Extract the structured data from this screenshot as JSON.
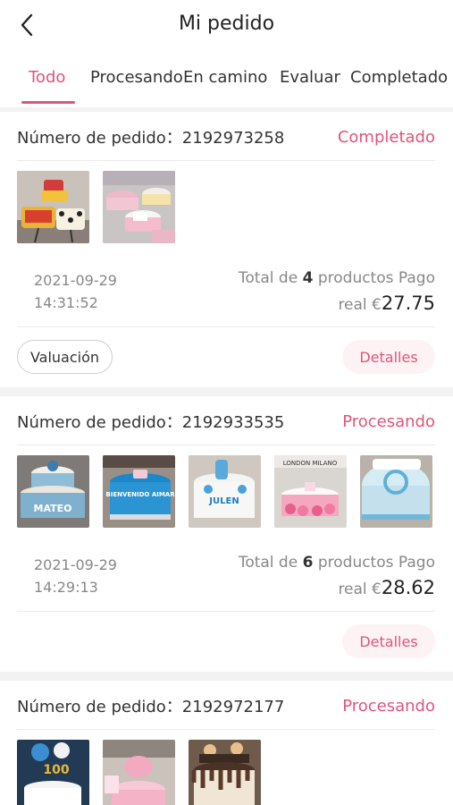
{
  "header": {
    "title": "Mi pedido",
    "back_icon": "chevron-left-icon"
  },
  "tabs": [
    {
      "label": "Todo",
      "active": true
    },
    {
      "label": "Procesando",
      "active": false
    },
    {
      "label": "En camino",
      "active": false
    },
    {
      "label": "Evaluar",
      "active": false
    },
    {
      "label": "Completado",
      "active": false
    }
  ],
  "orders": [
    {
      "number_label": "Número de pedido：2192973258",
      "status": "Completado",
      "date": "2021-09-29",
      "time": "14:31:52",
      "total_prefix": "Total de ",
      "count": "4",
      "total_suffix": " productos Pago",
      "real_label": "real €",
      "amount": "27.75",
      "valuation_label": "Valuación",
      "details_label": "Detalles"
    },
    {
      "number_label": "Número de pedido：2192933535",
      "status": "Procesando",
      "date": "2021-09-29",
      "time": "14:29:13",
      "total_prefix": "Total de ",
      "count": "6",
      "total_suffix": " productos Pago",
      "real_label": "real €",
      "amount": "28.62",
      "details_label": "Detalles",
      "cake_texts": [
        "MATEO",
        "BIENVENIDO AIMAR",
        "JULEN",
        "LONDON MILANO"
      ]
    },
    {
      "number_label": "Número de pedido：2192972177",
      "status": "Procesando",
      "cake_texts": [
        "100"
      ]
    }
  ],
  "colors": {
    "accent": "#e0557a",
    "muted": "#888888",
    "background": "#f2f2f2"
  }
}
